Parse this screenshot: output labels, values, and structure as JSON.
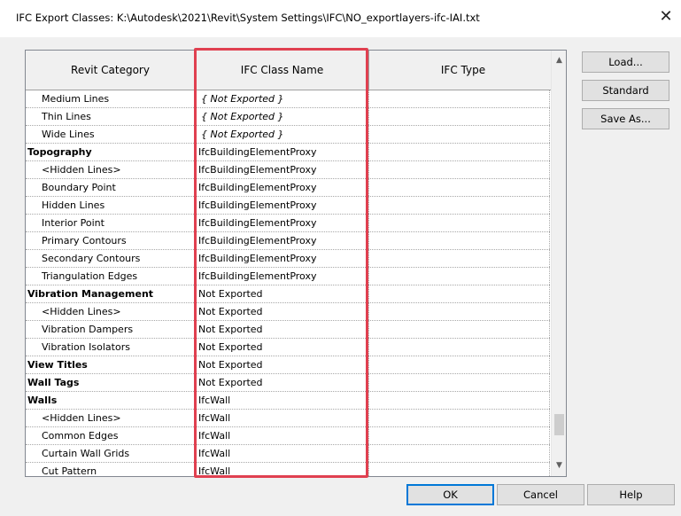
{
  "window": {
    "title": "IFC Export Classes: K:\\Autodesk\\2021\\Revit\\System Settings\\IFC\\NO_exportlayers-ifc-IAI.txt",
    "close_label": "✕"
  },
  "table": {
    "columns": [
      "Revit Category",
      "IFC Class Name",
      "IFC Type"
    ],
    "rows": [
      {
        "category": "Medium Lines",
        "ifc_class": "{ Not Exported }",
        "ifc_type": "",
        "top": false
      },
      {
        "category": "Thin Lines",
        "ifc_class": "{ Not Exported }",
        "ifc_type": "",
        "top": false
      },
      {
        "category": "Wide Lines",
        "ifc_class": "{ Not Exported }",
        "ifc_type": "",
        "top": false
      },
      {
        "category": "Topography",
        "ifc_class": "IfcBuildingElementProxy",
        "ifc_type": "",
        "top": true
      },
      {
        "category": "<Hidden Lines>",
        "ifc_class": "IfcBuildingElementProxy",
        "ifc_type": "",
        "top": false
      },
      {
        "category": "Boundary Point",
        "ifc_class": "IfcBuildingElementProxy",
        "ifc_type": "",
        "top": false
      },
      {
        "category": "Hidden Lines",
        "ifc_class": "IfcBuildingElementProxy",
        "ifc_type": "",
        "top": false
      },
      {
        "category": "Interior Point",
        "ifc_class": "IfcBuildingElementProxy",
        "ifc_type": "",
        "top": false
      },
      {
        "category": "Primary Contours",
        "ifc_class": "IfcBuildingElementProxy",
        "ifc_type": "",
        "top": false
      },
      {
        "category": "Secondary Contours",
        "ifc_class": "IfcBuildingElementProxy",
        "ifc_type": "",
        "top": false
      },
      {
        "category": "Triangulation Edges",
        "ifc_class": "IfcBuildingElementProxy",
        "ifc_type": "",
        "top": false
      },
      {
        "category": "Vibration Management",
        "ifc_class": "Not Exported",
        "ifc_type": "",
        "top": true
      },
      {
        "category": "<Hidden Lines>",
        "ifc_class": "Not Exported",
        "ifc_type": "",
        "top": false
      },
      {
        "category": "Vibration Dampers",
        "ifc_class": "Not Exported",
        "ifc_type": "",
        "top": false
      },
      {
        "category": "Vibration Isolators",
        "ifc_class": "Not Exported",
        "ifc_type": "",
        "top": false
      },
      {
        "category": "View Titles",
        "ifc_class": "Not Exported",
        "ifc_type": "",
        "top": true
      },
      {
        "category": "Wall Tags",
        "ifc_class": "Not Exported",
        "ifc_type": "",
        "top": true
      },
      {
        "category": "Walls",
        "ifc_class": "IfcWall",
        "ifc_type": "",
        "top": true
      },
      {
        "category": "<Hidden Lines>",
        "ifc_class": "IfcWall",
        "ifc_type": "",
        "top": false
      },
      {
        "category": "Common Edges",
        "ifc_class": "IfcWall",
        "ifc_type": "",
        "top": false
      },
      {
        "category": "Curtain Wall Grids",
        "ifc_class": "IfcWall",
        "ifc_type": "",
        "top": false
      },
      {
        "category": "Cut Pattern",
        "ifc_class": "IfcWall",
        "ifc_type": "",
        "top": false
      }
    ]
  },
  "scrollbar": {
    "up_icon": "▲",
    "down_icon": "▼"
  },
  "side_buttons": {
    "load": "Load...",
    "standard": "Standard",
    "save_as": "Save As..."
  },
  "footer_buttons": {
    "ok": "OK",
    "cancel": "Cancel",
    "help": "Help"
  },
  "colors": {
    "highlight": "#e04050",
    "header_bg": "#f0f0f0",
    "dialog_bg": "#f0f0f0"
  }
}
